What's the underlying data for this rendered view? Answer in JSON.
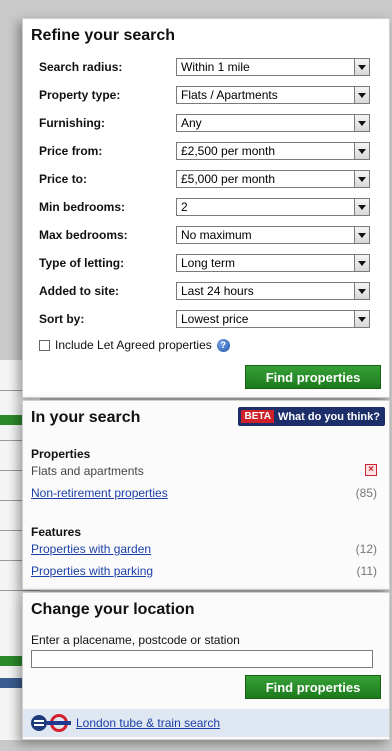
{
  "refine": {
    "title": "Refine your search",
    "fields": [
      {
        "label": "Search radius:",
        "value": "Within 1 mile"
      },
      {
        "label": "Property type:",
        "value": "Flats / Apartments"
      },
      {
        "label": "Furnishing:",
        "value": "Any"
      },
      {
        "label": "Price from:",
        "value": "£2,500 per month"
      },
      {
        "label": "Price to:",
        "value": "£5,000 per month"
      },
      {
        "label": "Min bedrooms:",
        "value": "2"
      },
      {
        "label": "Max bedrooms:",
        "value": "No maximum"
      },
      {
        "label": "Type of letting:",
        "value": "Long term"
      },
      {
        "label": "Added to site:",
        "value": "Last 24 hours"
      },
      {
        "label": "Sort by:",
        "value": "Lowest price"
      }
    ],
    "checkbox_label": "Include Let Agreed properties",
    "help_glyph": "?",
    "find_button": "Find properties"
  },
  "in_search": {
    "title": "In your search",
    "beta_tag": "BETA",
    "beta_text": "What do you think?",
    "properties_heading": "Properties",
    "properties": [
      {
        "label": "Flats and apartments",
        "removable": true
      },
      {
        "label": "Non-retirement properties",
        "count": "(85)"
      }
    ],
    "features_heading": "Features",
    "features": [
      {
        "label": "Properties with garden",
        "count": "(12)"
      },
      {
        "label": "Properties with parking",
        "count": "(11)"
      }
    ],
    "remove_glyph": "×"
  },
  "location": {
    "title": "Change your location",
    "input_label": "Enter a placename, postcode or station",
    "input_value": "",
    "find_button": "Find properties",
    "tube_link": "London tube & train search"
  },
  "colors": {
    "find_button": "#1d7a1d",
    "link": "#1a3fa8",
    "beta_bg": "#1c2f6b",
    "beta_tag": "#d0202a"
  }
}
